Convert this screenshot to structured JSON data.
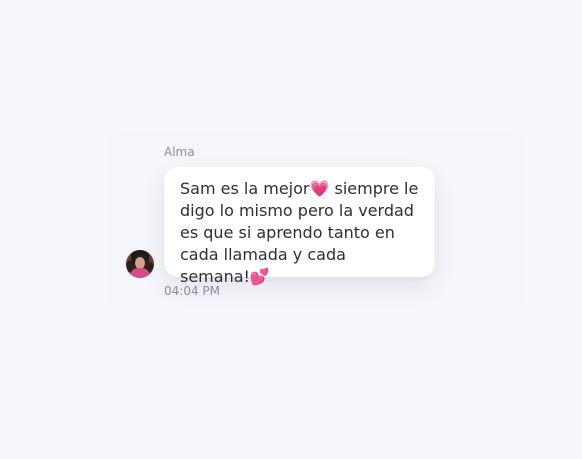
{
  "message": {
    "sender_name": "Alma",
    "text": "Sam es la mejor💗 siempre le digo lo mismo pero la verdad es que si aprendo tanto en cada llamada y cada semana!💕",
    "time": "04:04 PM"
  },
  "icons": {
    "avatar": "user-avatar-icon"
  },
  "colors": {
    "background": "#f6f7fb",
    "bubble": "#ffffff",
    "text": "#2f2f2f",
    "meta": "#8b8f9c"
  }
}
